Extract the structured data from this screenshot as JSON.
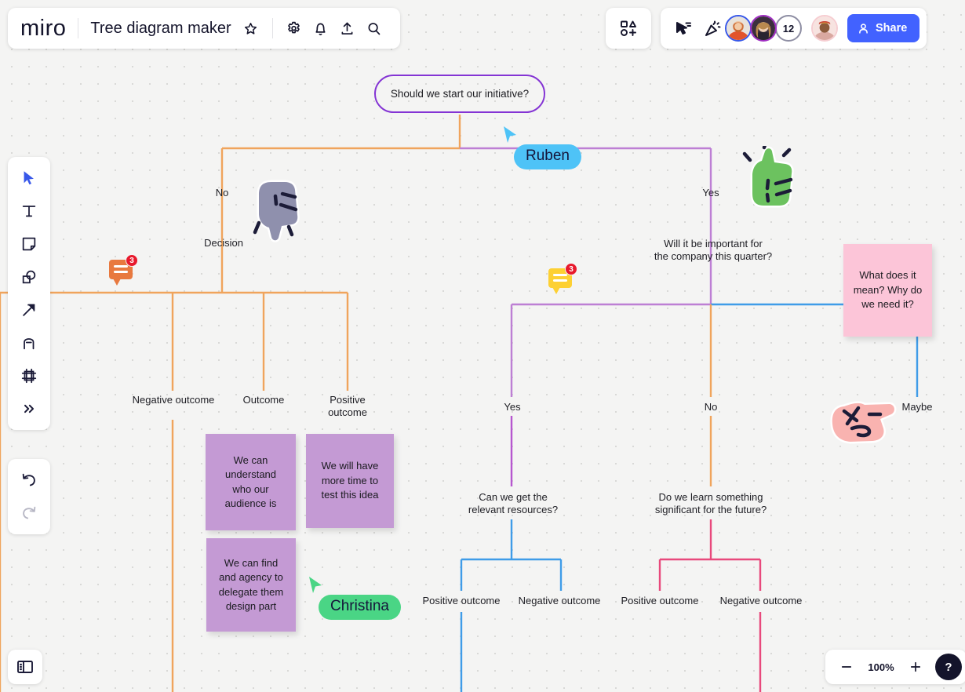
{
  "app": {
    "logo": "miro"
  },
  "header": {
    "board_title": "Tree diagram maker",
    "icons": {
      "favorite": "star-icon",
      "settings": "gear-icon",
      "notifications": "bell-icon",
      "upload": "upload-icon",
      "search": "search-icon",
      "frames": "frames-icon",
      "cursor_share": "cursor-share-icon",
      "celebrate": "party-popper-icon"
    },
    "presence": {
      "count_badge": "12"
    },
    "share_label": "Share"
  },
  "toolbar": {
    "items": [
      {
        "icon": "cursor-select-icon",
        "name": "select-tool"
      },
      {
        "icon": "text-icon",
        "name": "text-tool"
      },
      {
        "icon": "sticky-note-icon",
        "name": "sticky-note-tool"
      },
      {
        "icon": "shapes-icon",
        "name": "shapes-tool"
      },
      {
        "icon": "arrow-icon",
        "name": "connector-tool"
      },
      {
        "icon": "pen-icon",
        "name": "pen-tool"
      },
      {
        "icon": "frame-icon",
        "name": "frame-tool"
      },
      {
        "icon": "more-icon",
        "name": "more-tools"
      }
    ],
    "undo": "undo-icon",
    "redo": "redo-icon"
  },
  "footer": {
    "panel_toggle": "panel-toggle-icon",
    "zoom_out": "minus-icon",
    "zoom_level": "100%",
    "zoom_in": "plus-icon",
    "help": "?"
  },
  "board": {
    "root": {
      "text": "Should we start our initiative?"
    },
    "labels": [
      {
        "id": "no-left",
        "text": "No"
      },
      {
        "id": "decision",
        "text": "Decision"
      },
      {
        "id": "yes-right",
        "text": "Yes"
      },
      {
        "id": "q-quarter",
        "text": "Will it be important for\nthe company this quarter?"
      },
      {
        "id": "neg-outcome-1",
        "text": "Negative outcome"
      },
      {
        "id": "outcome-1",
        "text": "Outcome"
      },
      {
        "id": "pos-outcome-1",
        "text": "Positive\noutcome"
      },
      {
        "id": "yes-mid",
        "text": "Yes"
      },
      {
        "id": "no-mid",
        "text": "No"
      },
      {
        "id": "maybe",
        "text": "Maybe"
      },
      {
        "id": "q-resources",
        "text": "Can we get the\nrelevant resources?"
      },
      {
        "id": "q-learn",
        "text": "Do we learn something\nsignificant for the future?"
      },
      {
        "id": "pos-outcome-2",
        "text": "Positive outcome"
      },
      {
        "id": "neg-outcome-2",
        "text": "Negative outcome"
      },
      {
        "id": "pos-outcome-3",
        "text": "Positive outcome"
      },
      {
        "id": "neg-outcome-3",
        "text": "Negative outcome"
      }
    ],
    "stickies": [
      {
        "id": "sticky-audience",
        "text": "We can understand who our audience is",
        "color": "#c49ad4"
      },
      {
        "id": "sticky-time",
        "text": "We will have more time to test this idea",
        "color": "#c49ad4"
      },
      {
        "id": "sticky-agency",
        "text": "We can find and agency to delegate them design part",
        "color": "#c49ad4"
      },
      {
        "id": "sticky-meaning",
        "text": "What does it mean? Why do we need it?",
        "color": "#fcc5d8"
      }
    ],
    "cursors": [
      {
        "id": "cursor-ruben",
        "name": "Ruben",
        "color": "#4ec3f7"
      },
      {
        "id": "cursor-christina",
        "name": "Christina",
        "color": "#4ad585"
      }
    ],
    "comments": [
      {
        "id": "comment-orange",
        "count": "3",
        "color": "#e8793f"
      },
      {
        "id": "comment-yellow",
        "count": "3",
        "color": "#fdd033"
      }
    ],
    "stickers": [
      {
        "id": "thumbs-down-sticker",
        "icon": "thumbs-down-icon",
        "color": "#8f90ad"
      },
      {
        "id": "thumbs-up-sticker",
        "icon": "thumbs-up-icon",
        "color": "#6cc25f"
      },
      {
        "id": "pointing-hand-sticker",
        "icon": "pointing-hand-icon",
        "color": "#f9b3b0"
      }
    ],
    "edge_colors": {
      "orange": "#f0a45c",
      "purple": "#bd7fd4",
      "blue": "#3f9ce8",
      "pink": "#e8497c",
      "violet": "#b657cf"
    }
  }
}
